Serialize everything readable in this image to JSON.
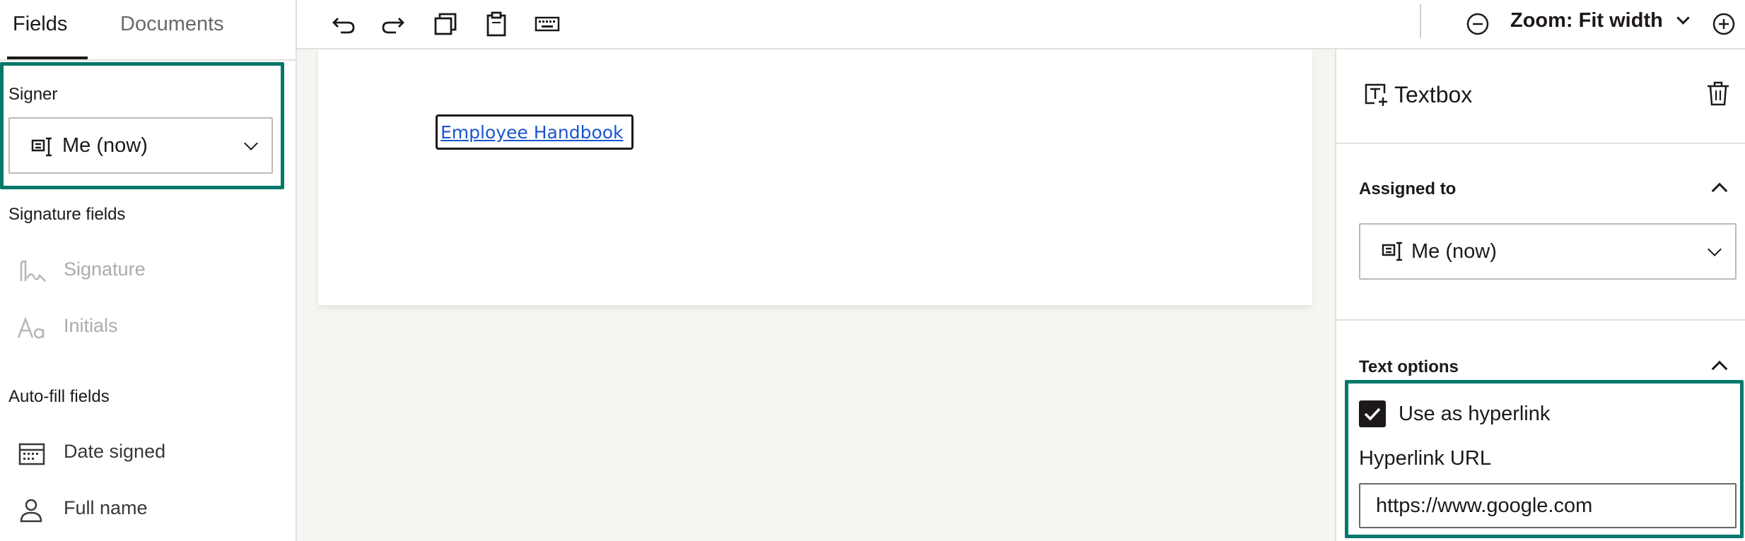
{
  "left_panel": {
    "tabs": [
      {
        "label": "Fields",
        "active": true
      },
      {
        "label": "Documents",
        "active": false
      }
    ],
    "signer": {
      "label": "Signer",
      "value": "Me (now)"
    },
    "signature_fields": {
      "heading": "Signature fields",
      "items": [
        {
          "label": "Signature",
          "icon": "signature-icon",
          "disabled": true
        },
        {
          "label": "Initials",
          "icon": "initials-icon",
          "disabled": true
        }
      ]
    },
    "autofill_fields": {
      "heading": "Auto-fill fields",
      "items": [
        {
          "label": "Date signed",
          "icon": "calendar-icon"
        },
        {
          "label": "Full name",
          "icon": "person-icon"
        }
      ]
    }
  },
  "toolbar": {
    "buttons": [
      "undo-icon",
      "redo-icon",
      "copy-icon",
      "paste-icon",
      "keyboard-icon"
    ],
    "zoom_label": "Zoom: Fit width"
  },
  "document": {
    "link_text": "Employee Handbook"
  },
  "properties": {
    "title": "Textbox",
    "assigned_to": {
      "heading": "Assigned to",
      "value": "Me (now)"
    },
    "text_options": {
      "heading": "Text options",
      "use_as_hyperlink_label": "Use as hyperlink",
      "use_as_hyperlink_checked": true,
      "hyperlink_url_label": "Hyperlink URL",
      "hyperlink_url_value": "https://www.google.com"
    }
  },
  "colors": {
    "highlight": "#00786a",
    "link": "#1a55d0",
    "canvas_bg": "#f7f5f2",
    "text": "#1e1919"
  }
}
